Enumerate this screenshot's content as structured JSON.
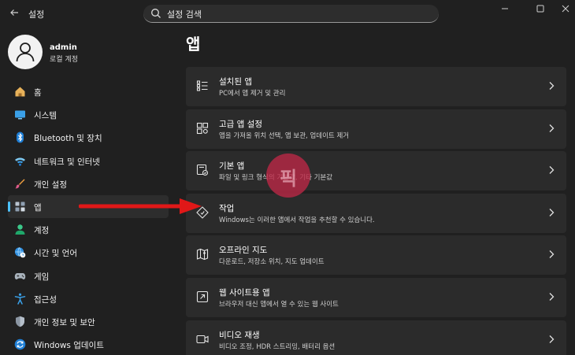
{
  "window": {
    "title": "설정",
    "search_text": "설정 검색",
    "controls": [
      "minimize",
      "maximize",
      "close"
    ]
  },
  "profile": {
    "name": "admin",
    "account_type": "로컬 계정"
  },
  "sidebar": {
    "items": [
      {
        "label": "홈",
        "icon": "home-icon",
        "active": false
      },
      {
        "label": "시스템",
        "icon": "monitor-icon",
        "active": false
      },
      {
        "label": "Bluetooth 및 장치",
        "icon": "bluetooth-icon",
        "active": false
      },
      {
        "label": "네트워크 및 인터넷",
        "icon": "wifi-icon",
        "active": false
      },
      {
        "label": "개인 설정",
        "icon": "brush-icon",
        "active": false
      },
      {
        "label": "앱",
        "icon": "apps-icon",
        "active": true
      },
      {
        "label": "계정",
        "icon": "person-icon",
        "active": false
      },
      {
        "label": "시간 및 언어",
        "icon": "globe-clock-icon",
        "active": false
      },
      {
        "label": "게임",
        "icon": "gamepad-icon",
        "active": false
      },
      {
        "label": "접근성",
        "icon": "accessibility-icon",
        "active": false
      },
      {
        "label": "개인 정보 및 보안",
        "icon": "shield-icon",
        "active": false
      },
      {
        "label": "Windows 업데이트",
        "icon": "update-icon",
        "active": false
      }
    ]
  },
  "main": {
    "title": "앱",
    "cards": [
      {
        "title": "설치된 앱",
        "subtitle": "PC에서 앱 제거 및 관리",
        "icon": "installed-apps-icon"
      },
      {
        "title": "고급 앱 설정",
        "subtitle": "앱을 가져올 위치 선택, 앱 보관, 업데이트 제거",
        "icon": "advanced-apps-icon"
      },
      {
        "title": "기본 앱",
        "subtitle": "파일 및 링크 형식의 기본값, 기타 기본값",
        "icon": "default-apps-icon"
      },
      {
        "title": "작업",
        "subtitle": "Windows는 이러한 앱에서 작업을 추천할 수 있습니다.",
        "icon": "actions-icon"
      },
      {
        "title": "오프라인 지도",
        "subtitle": "다운로드, 저장소 위치, 지도 업데이트",
        "icon": "map-icon"
      },
      {
        "title": "웹 사이트용 앱",
        "subtitle": "브라우저 대신 앱에서 열 수 있는 웹 사이트",
        "icon": "open-external-icon"
      },
      {
        "title": "비디오 재생",
        "subtitle": "비디오 조정, HDR 스트리밍, 배터리 옵션",
        "icon": "video-icon"
      }
    ]
  },
  "overlay": {
    "watermark_text": "픽",
    "arrow_color": "#e01818"
  },
  "colors": {
    "background": "#202020",
    "card": "#2b2b2b",
    "accent": "#4cc2ff"
  }
}
